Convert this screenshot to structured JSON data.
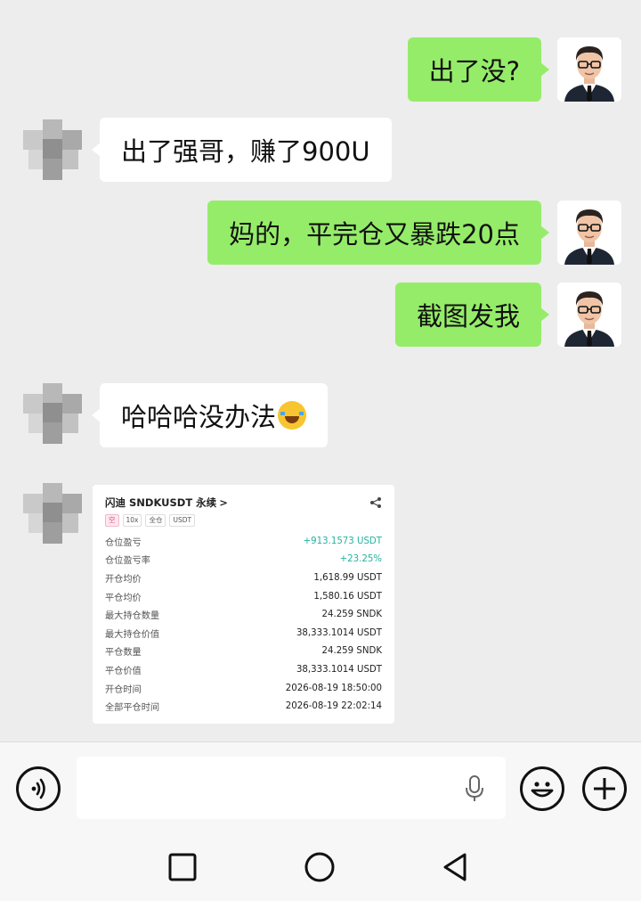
{
  "messages": [
    {
      "side": "me",
      "text": "出了没?"
    },
    {
      "side": "other",
      "text": "出了强哥，赚了900U"
    },
    {
      "side": "me",
      "text": "妈的，平完仓又暴跌20点"
    },
    {
      "side": "me",
      "text": "截图发我"
    },
    {
      "side": "other",
      "text": "哈哈哈没办法",
      "emoji": "tears-of-joy"
    }
  ],
  "card": {
    "title": "闪迪 SNDKUSDT 永续",
    "chevron": ">",
    "tags": [
      "空",
      "10x",
      "全仓",
      "USDT"
    ],
    "rows": [
      {
        "label": "仓位盈亏",
        "value": "+913.1573 USDT"
      },
      {
        "label": "仓位盈亏率",
        "value": "+23.25%"
      },
      {
        "label": "开仓均价",
        "value": "1,618.99 USDT"
      },
      {
        "label": "平仓均价",
        "value": "1,580.16 USDT"
      },
      {
        "label": "最大持仓数量",
        "value": "24.259 SNDK"
      },
      {
        "label": "最大持仓价值",
        "value": "38,333.1014 USDT"
      },
      {
        "label": "平仓数量",
        "value": "24.259 SNDK"
      },
      {
        "label": "平仓价值",
        "value": "38,333.1014 USDT"
      },
      {
        "label": "开仓时间",
        "value": "2026-08-19 18:50:00"
      },
      {
        "label": "全部平仓时间",
        "value": "2026-08-19 22:02:14"
      }
    ]
  },
  "colors": {
    "my_bubble": "#95ec69",
    "other_bubble": "#ffffff",
    "chat_bg": "#ededed",
    "profit_green": "#22b3a0"
  },
  "icons": {
    "voice": "voice-icon",
    "mic": "mic-icon",
    "emoji": "emoji-icon",
    "add": "plus-icon",
    "nav_recent": "square-icon",
    "nav_home": "circle-icon",
    "nav_back": "triangle-back-icon"
  }
}
